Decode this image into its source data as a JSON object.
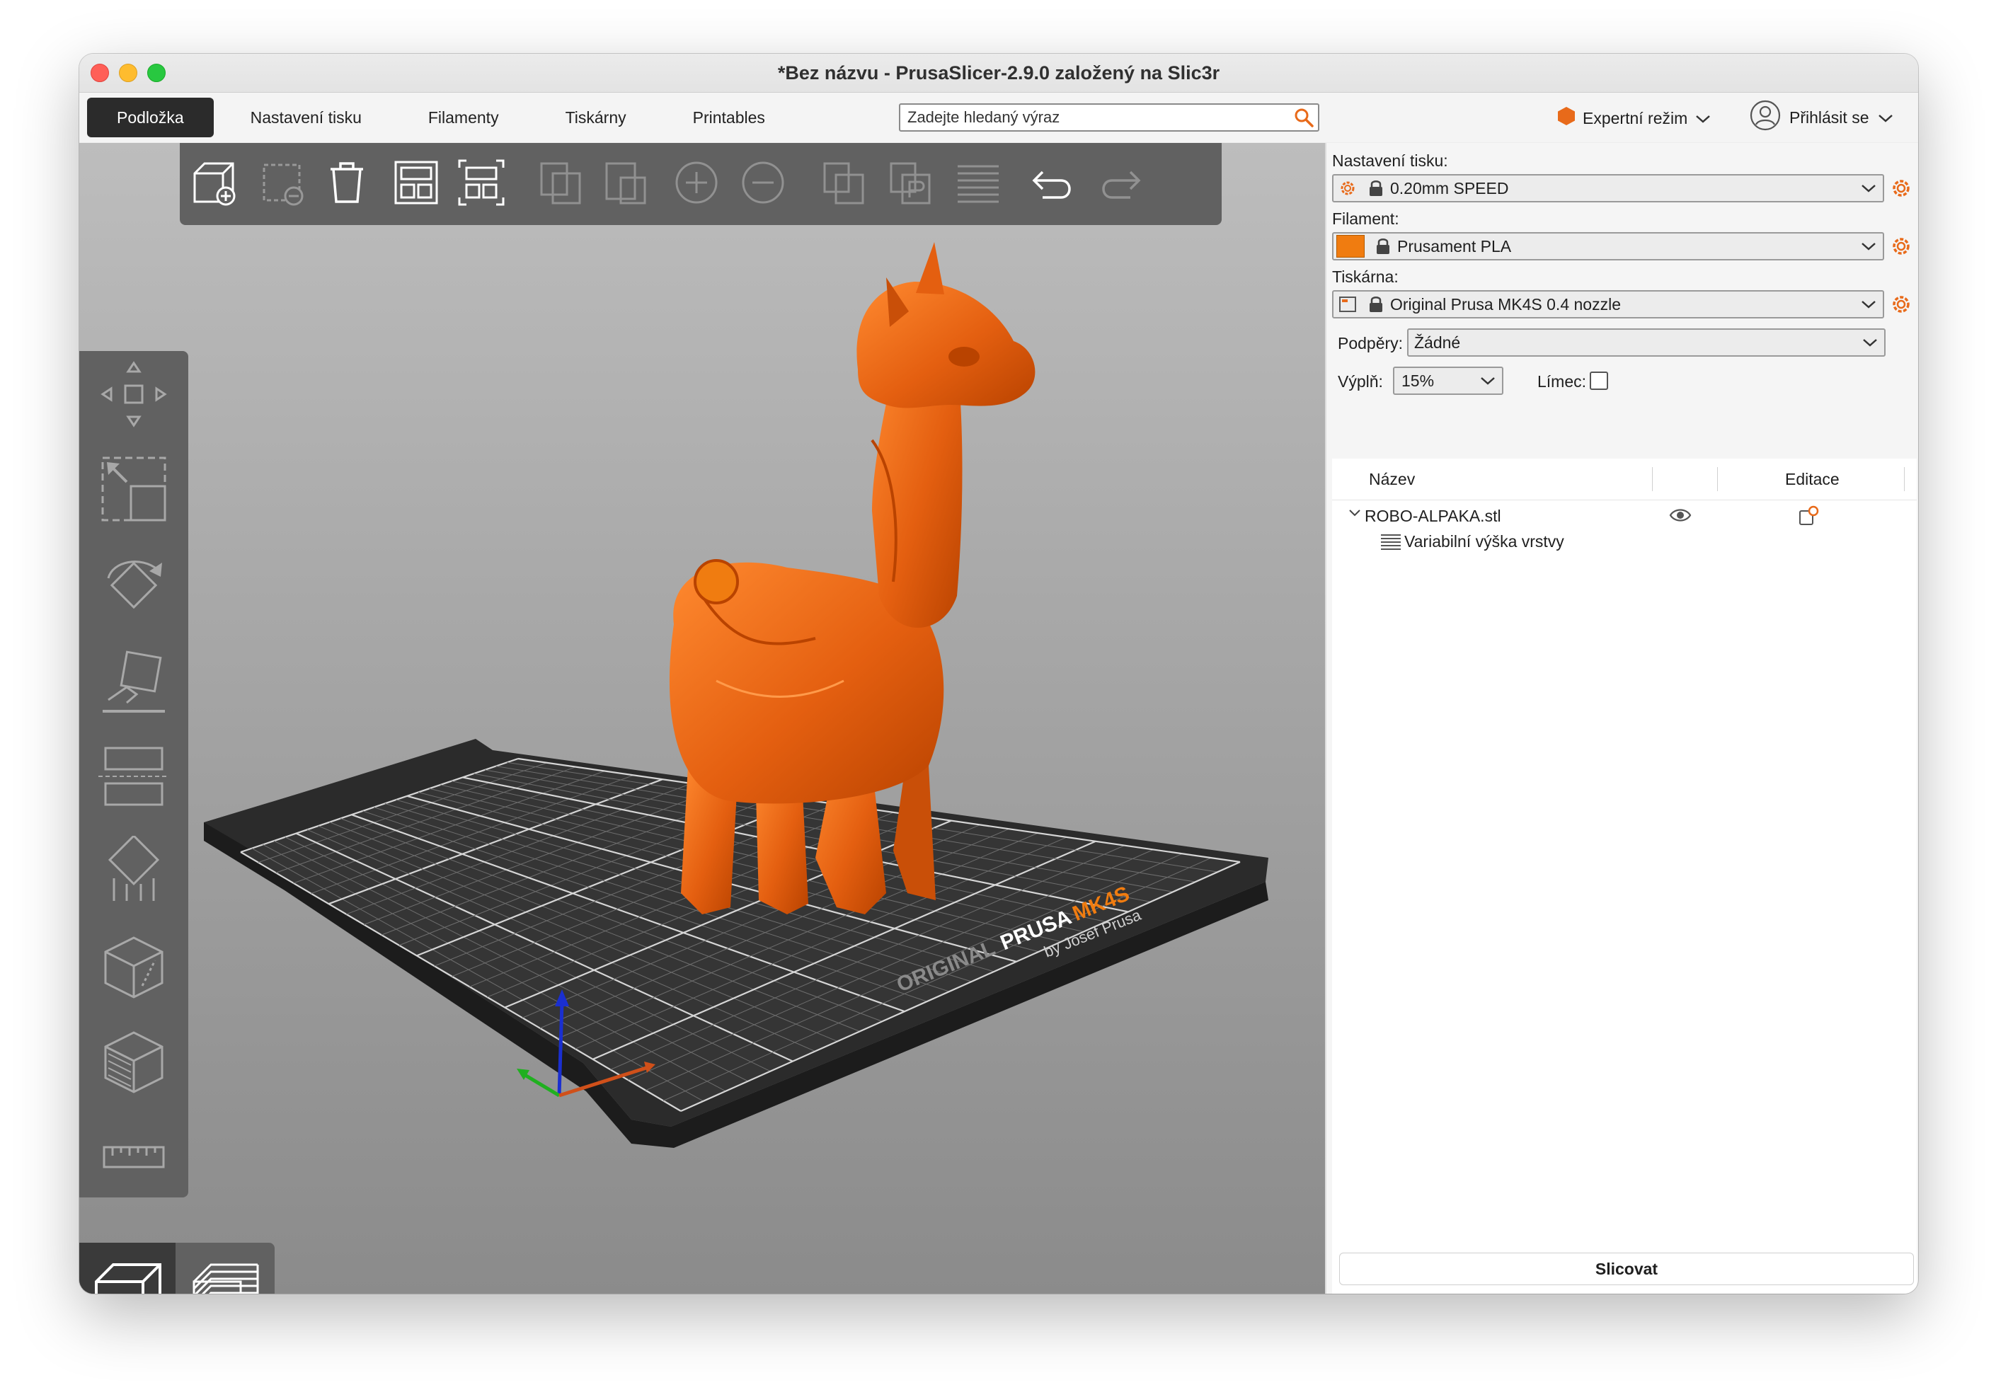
{
  "window": {
    "title": "*Bez názvu - PrusaSlicer-2.9.0 založený na Slic3r"
  },
  "tabs": [
    {
      "label": "Podložka",
      "active": true
    },
    {
      "label": "Nastavení tisku",
      "active": false
    },
    {
      "label": "Filamenty",
      "active": false
    },
    {
      "label": "Tiskárny",
      "active": false
    },
    {
      "label": "Printables",
      "active": false
    }
  ],
  "search": {
    "placeholder": "Zadejte hledaný výraz"
  },
  "mode": {
    "label": "Expertní režim",
    "color": "#e86a1a"
  },
  "account": {
    "label": "Přihlásit se"
  },
  "top_toolbar": [
    "add-icon",
    "delete-icon",
    "delete-all-icon",
    "arrange-icon",
    "arrange-selection-icon",
    "copy-icon",
    "paste-icon",
    "add-instance-icon",
    "remove-instance-icon",
    "split-objects-icon",
    "split-parts-icon",
    "layers-editing-icon",
    "undo-icon",
    "redo-icon"
  ],
  "left_toolbar": [
    "move-icon",
    "scale-icon",
    "rotate-icon",
    "place-on-face-icon",
    "cut-icon",
    "support-paint-icon",
    "seam-paint-icon",
    "fuzzy-skin-icon",
    "measure-icon"
  ],
  "view_switch": [
    "3d-view-icon",
    "preview-icon"
  ],
  "sidebar": {
    "print_settings_label": "Nastavení tisku:",
    "print_settings_value": "0.20mm SPEED",
    "filament_label": "Filament:",
    "filament_value": "Prusament PLA",
    "filament_color": "#f07c10",
    "printer_label": "Tiskárna:",
    "printer_value": "Original Prusa MK4S 0.4 nozzle",
    "supports_label": "Podpěry:",
    "supports_value": "Žádné",
    "infill_label": "Výplň:",
    "infill_value": "15%",
    "brim_label": "Límec:",
    "brim_checked": false,
    "list": {
      "col_name": "Název",
      "col_edit": "Editace",
      "object_name": "ROBO-ALPAKA.stl",
      "sub_item": "Variabilní výška vrstvy"
    },
    "slice_button": "Slicovat"
  },
  "bed": {
    "logo_line1": "ORIGINAL",
    "logo_line2": "PRUSA",
    "logo_line3": "MK4S",
    "logo_line4": "by Josef Prusa",
    "model_color": "#e45f10"
  }
}
